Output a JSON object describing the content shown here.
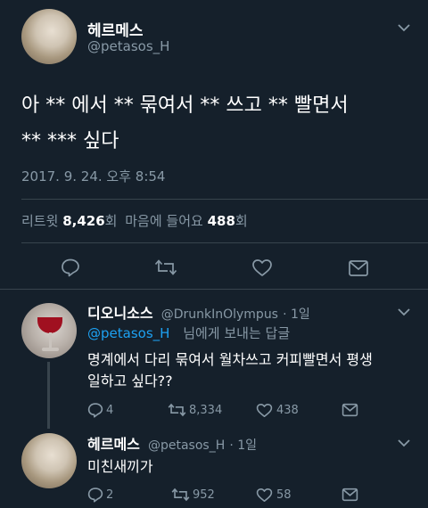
{
  "main_tweet": {
    "display_name": "헤르메스",
    "handle": "@petasos_H",
    "text_line1": "아 ** 에서 ** 묶여서 ** 쓰고 ** 빨면서",
    "text_line2": "** *** 싶다",
    "timestamp": "2017. 9. 24. 오후 8:54",
    "retweets_label": "리트윗",
    "retweets_count": "8,426",
    "retweets_unit": "회",
    "likes_label": "마음에 들어요",
    "likes_count": "488",
    "likes_unit": "회"
  },
  "reply1": {
    "display_name": "디오니소스",
    "handle": "@DrunkInOlympus",
    "time": "· 1일",
    "reply_to_handle": "@petasos_H",
    "reply_to_suffix": "님에게 보내는 답글",
    "text_line1": "명계에서 다리 묶여서 월차쓰고 커피빨면서 평생",
    "text_line2": "일하고 싶다??",
    "replies": "4",
    "retweets": "8,334",
    "likes": "438"
  },
  "reply2": {
    "display_name": "헤르메스",
    "handle": "@petasos_H",
    "time": "· 1일",
    "text": "미친새끼가",
    "replies": "2",
    "retweets": "952",
    "likes": "58"
  }
}
